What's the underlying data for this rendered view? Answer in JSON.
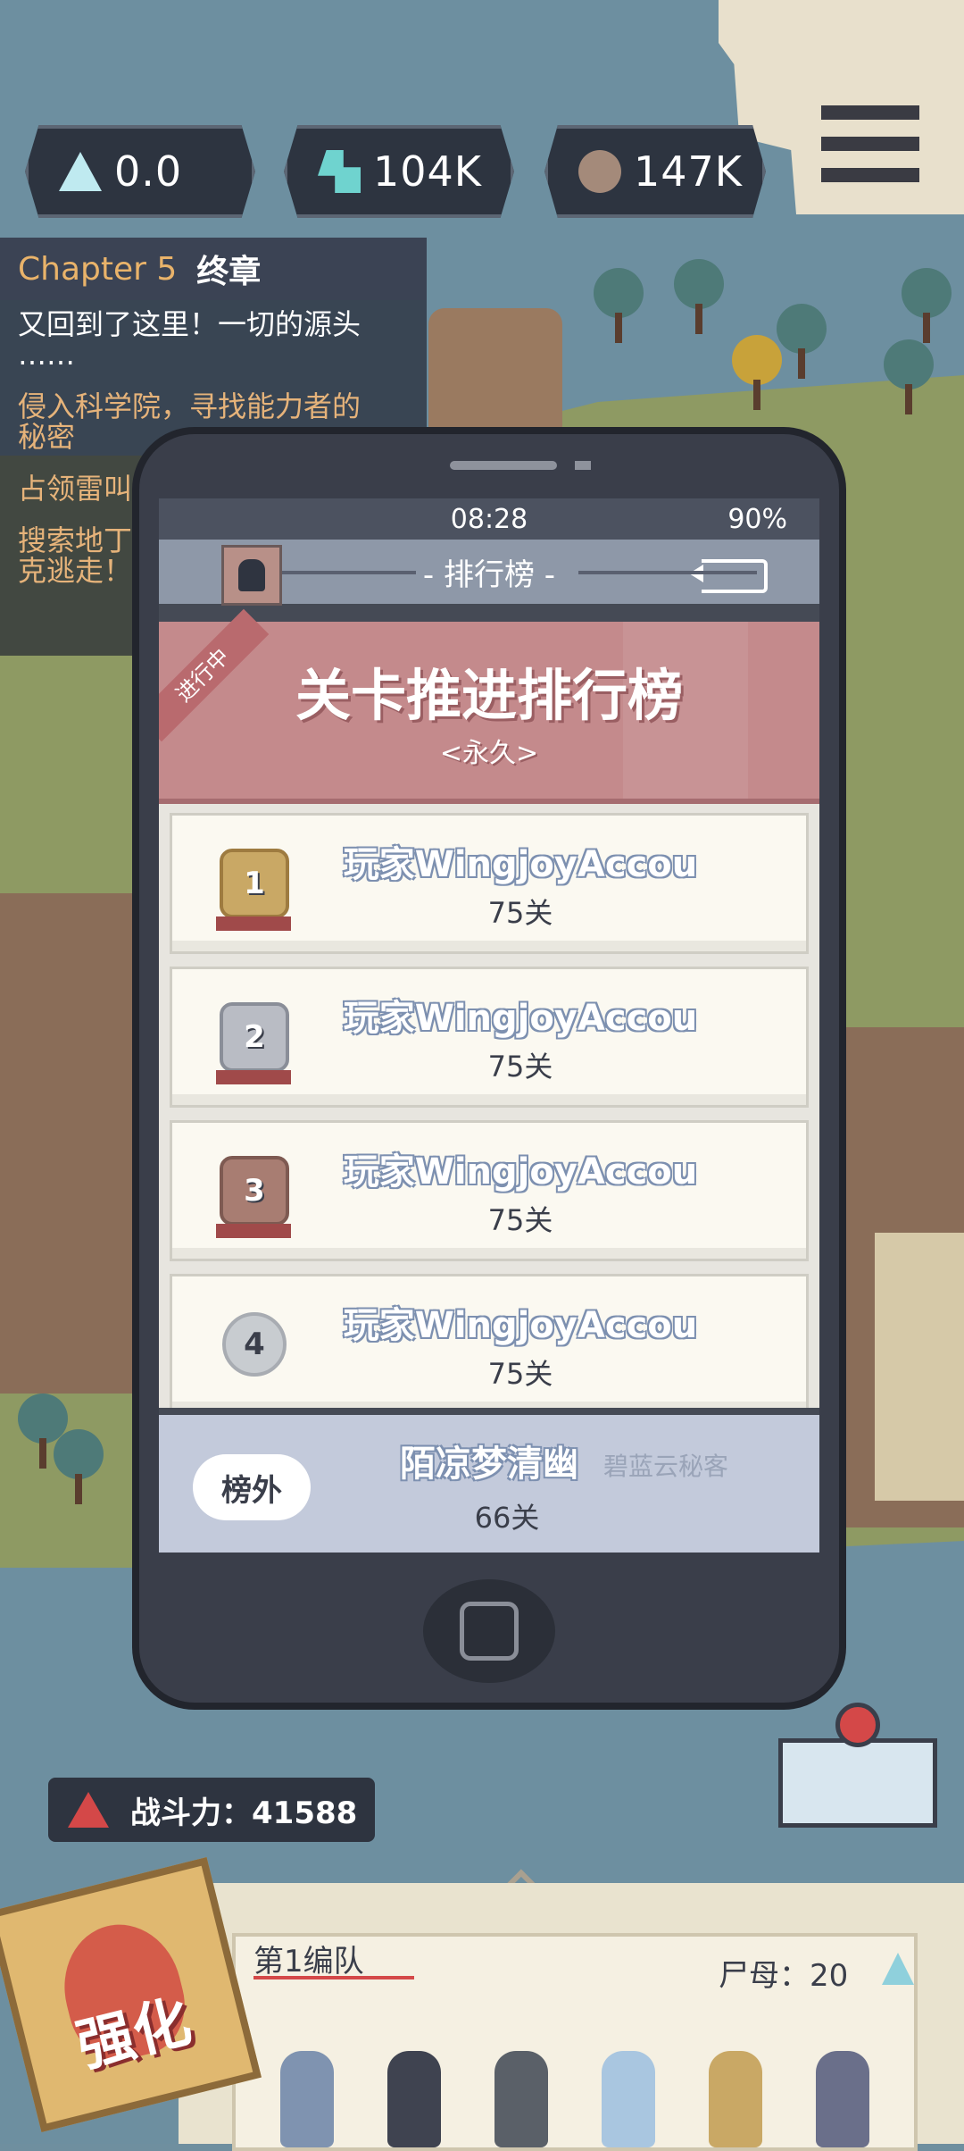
{
  "resources": [
    {
      "icon": "crystal-icon",
      "value": "0.0"
    },
    {
      "icon": "gem-cluster-icon",
      "value": "104K"
    },
    {
      "icon": "brain-icon",
      "value": "147K"
    }
  ],
  "quest": {
    "chapter": "Chapter 5",
    "chapter_name": "终章",
    "items": [
      {
        "line1": "又回到了这里！一切的源头",
        "line2": "……"
      },
      {
        "line1": "侵入科学院，寻找能力者的",
        "line2": "秘密"
      },
      {
        "line1": "占领雷叫",
        "line2": ""
      },
      {
        "line1": "搜索地丁",
        "line2": "克逃走！"
      }
    ]
  },
  "phone": {
    "time": "08:28",
    "battery": "90%",
    "title": "- 排行榜 -",
    "banner_tag": "进行中",
    "board_title": "关卡推进排行榜",
    "board_sub": "<永久>",
    "ranks": [
      {
        "rank": "1",
        "name": "玩家WingjoyAccou",
        "level": "75关"
      },
      {
        "rank": "2",
        "name": "玩家WingjoyAccou",
        "level": "75关"
      },
      {
        "rank": "3",
        "name": "玩家WingjoyAccou",
        "level": "75关"
      },
      {
        "rank": "4",
        "name": "玩家WingjoyAccou",
        "level": "75关"
      }
    ],
    "self": {
      "badge": "榜外",
      "name": "陌凉梦清幽",
      "guild": "碧蓝云秘客",
      "level": "66关"
    }
  },
  "power": {
    "label": "战斗力：41588"
  },
  "team": {
    "label": "第1编队",
    "corpse": "尸母：20"
  },
  "strengthen": {
    "label": "强化"
  },
  "colors": {
    "accent_red": "#d44848",
    "banner": "#c48a8c",
    "gold": "#c9a865",
    "silver": "#b9bcc4",
    "bronze": "#a87d72"
  }
}
